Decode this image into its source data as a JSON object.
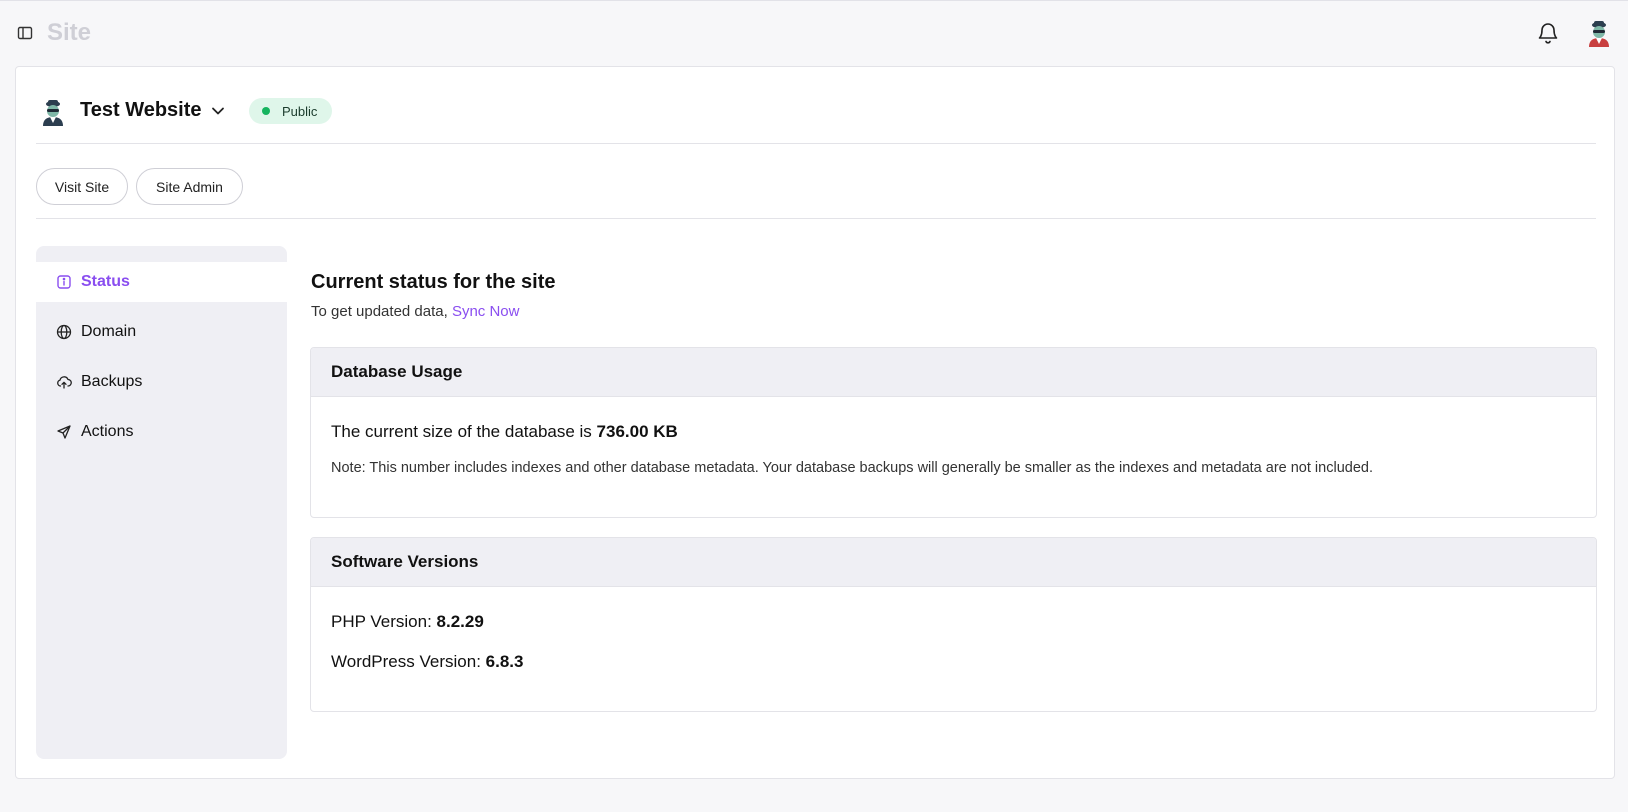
{
  "app": {
    "title": "Site"
  },
  "site": {
    "name": "Test Website",
    "visibility": "Public",
    "visibility_color": "#16b45f"
  },
  "actions": {
    "visit_label": "Visit Site",
    "admin_label": "Site Admin"
  },
  "nav": {
    "items": [
      {
        "label": "Status",
        "icon": "info-icon",
        "active": true
      },
      {
        "label": "Domain",
        "icon": "globe-icon"
      },
      {
        "label": "Backups",
        "icon": "cloud-upload-icon"
      },
      {
        "label": "Actions",
        "icon": "send-icon"
      }
    ]
  },
  "content": {
    "title": "Current status for the site",
    "subtitle_prefix": "To get updated data, ",
    "sync_link": "Sync Now"
  },
  "database": {
    "heading": "Database Usage",
    "size_prefix": "The current size of the database is ",
    "size_value": "736.00 KB",
    "note": "Note: This number includes indexes and other database metadata. Your database backups will generally be smaller as the indexes and metadata are not included."
  },
  "software": {
    "heading": "Software Versions",
    "php_label": "PHP Version: ",
    "php_value": "8.2.29",
    "wp_label": "WordPress Version: ",
    "wp_value": "6.8.3"
  },
  "colors": {
    "accent": "#8a4ef0",
    "badge_bg": "#dff6ea"
  }
}
